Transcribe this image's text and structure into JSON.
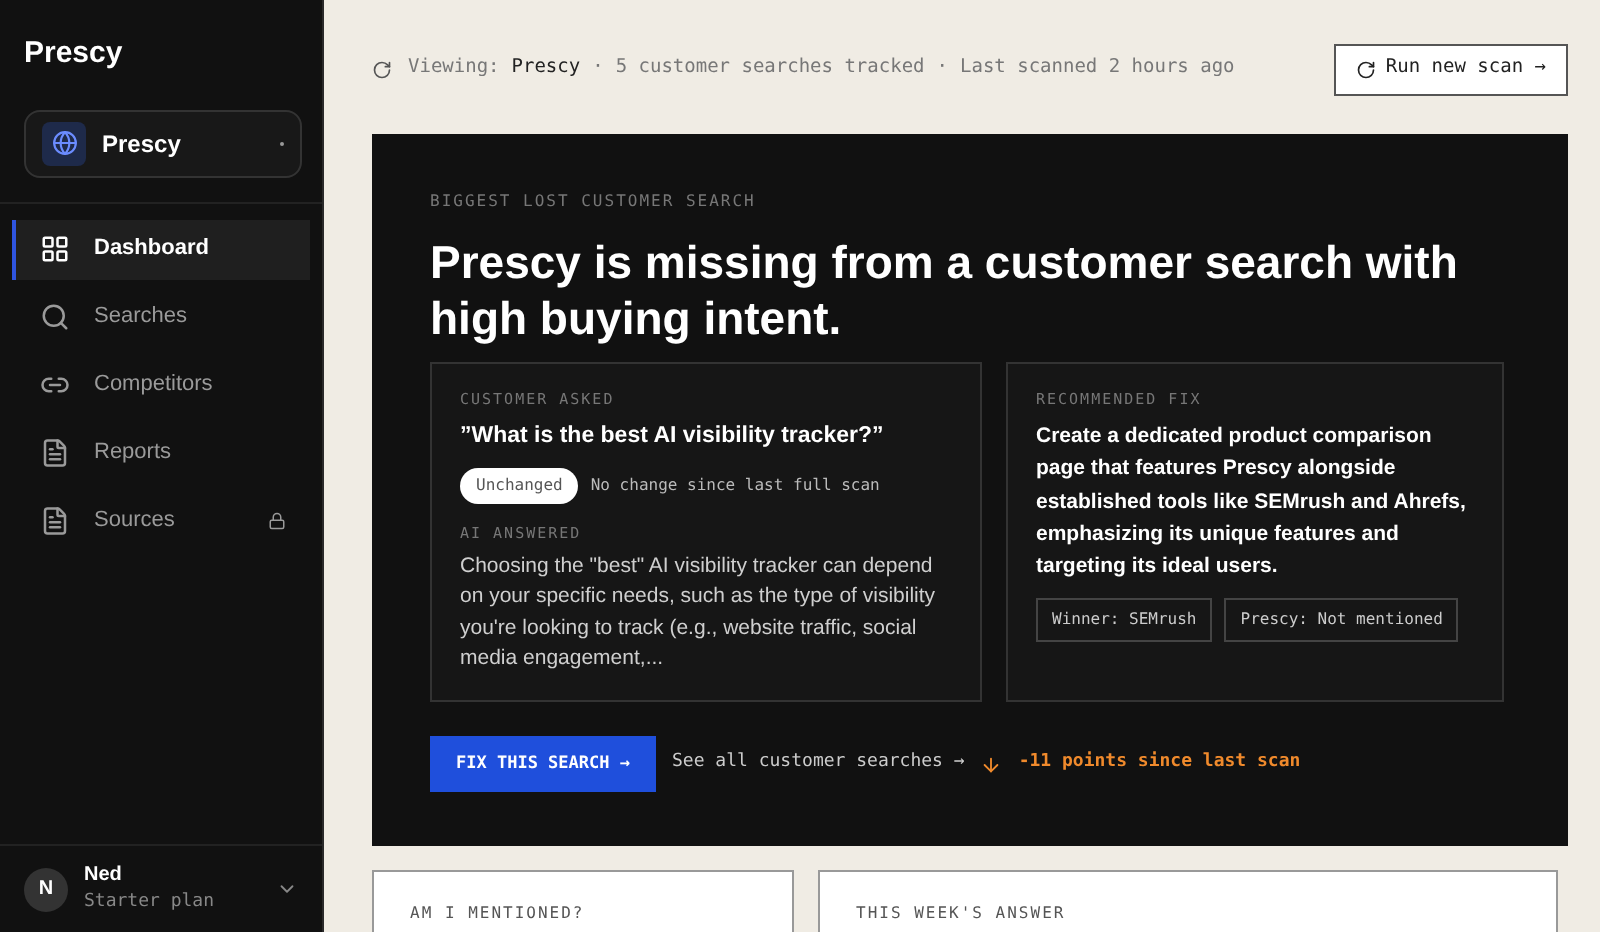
{
  "sidebar": {
    "brand": "Prescy",
    "workspace": {
      "name": "Prescy"
    },
    "items": [
      {
        "kind": "grid",
        "label": "Dashboard",
        "selected": true,
        "locked": false
      },
      {
        "kind": "search",
        "label": "Searches",
        "selected": false,
        "locked": false
      },
      {
        "kind": "link",
        "label": "Competitors",
        "selected": false,
        "locked": false
      },
      {
        "kind": "doc",
        "label": "Reports",
        "selected": false,
        "locked": false
      },
      {
        "kind": "doc",
        "label": "Sources",
        "selected": false,
        "locked": true
      }
    ],
    "user": {
      "initial": "N",
      "name": "Ned",
      "plan": "Starter plan"
    }
  },
  "topbar": {
    "separator": "·",
    "viewing_label": "Viewing:",
    "viewing_name": "Prescy",
    "tracked": "5 customer searches tracked",
    "scanned": "Last scanned 2 hours ago",
    "scan_button": "Run new scan →"
  },
  "hero": {
    "eyebrow": "BIGGEST LOST CUSTOMER SEARCH",
    "title": "Prescy is missing from a customer search with high buying intent.",
    "asked": {
      "label": "CUSTOMER ASKED",
      "question": "”What is the best AI visibility tracker?”",
      "badge": "Unchanged",
      "badge_note": "No change since last full scan",
      "answer_label": "AI ANSWERED",
      "answer": "Choosing the \"best\" AI visibility tracker can depend on your specific needs, such as the type of visibility you're looking to track (e.g., website traffic, social media engagement,..."
    },
    "fix": {
      "label": "RECOMMENDED FIX",
      "text": "Create a dedicated product comparison page that features Prescy alongside established tools like SEMrush and Ahrefs, emphasizing its unique features and targeting its ideal users.",
      "tags": [
        "Winner: SEMrush",
        "Prescy: Not mentioned"
      ]
    },
    "fix_button": "FIX THIS SEARCH →",
    "see_all": "See all customer searches →",
    "delta": "-11 points since last scan"
  },
  "cards": [
    {
      "title": "AM I MENTIONED?"
    },
    {
      "title": "THIS WEEK'S ANSWER"
    }
  ]
}
